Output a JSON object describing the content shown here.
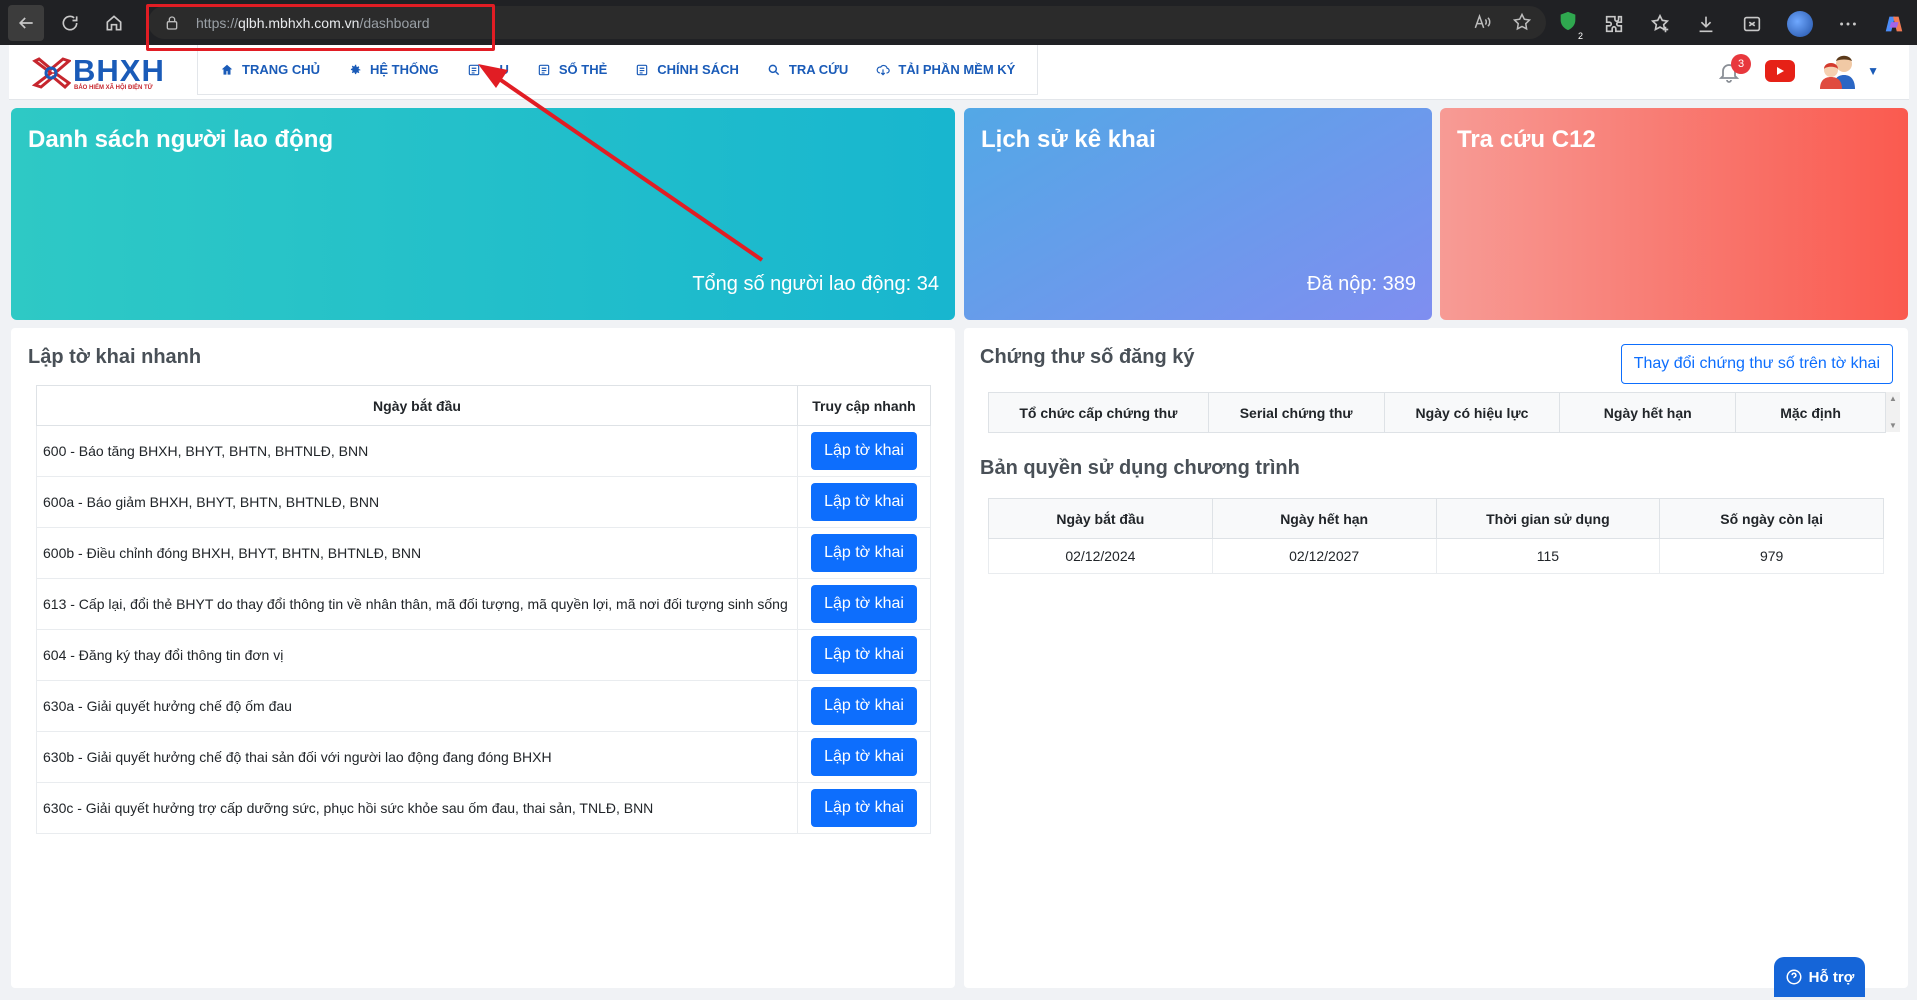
{
  "browser": {
    "url_prefix": "https://",
    "url_host": "qlbh.mbhxh.com.vn",
    "url_path": "/dashboard",
    "extension_badge": "2"
  },
  "header": {
    "logo_text": "BHXH",
    "logo_tagline": "BẢO HIỂM XÃ HỘI ĐIỆN TỬ",
    "menu": [
      {
        "label": "TRANG CHỦ",
        "icon": "home-icon"
      },
      {
        "label": "HỆ THỐNG",
        "icon": "gear-icon"
      },
      {
        "label": "...U",
        "icon": "document-icon"
      },
      {
        "label": "SỔ THẺ",
        "icon": "card-icon"
      },
      {
        "label": "CHÍNH SÁCH",
        "icon": "policy-icon"
      },
      {
        "label": "TRA CỨU",
        "icon": "search-icon"
      },
      {
        "label": "TẢI PHẦN MỀM KÝ",
        "icon": "cloud-download-icon"
      }
    ],
    "notification_count": "3"
  },
  "cards": [
    {
      "title": "Danh sách người lao động",
      "value": "Tổng số người lao động: 34"
    },
    {
      "title": "Lịch sử kê khai",
      "value": "Đã nộp: 389"
    },
    {
      "title": "Tra cứu C12",
      "value": ""
    }
  ],
  "quick_form": {
    "title": "Lập tờ khai nhanh",
    "col1": "Ngày bắt đầu",
    "col2": "Truy cập nhanh",
    "button_label": "Lập tờ khai",
    "rows": [
      "600 - Báo tăng BHXH, BHYT, BHTN, BHTNLĐ, BNN",
      "600a - Báo giảm BHXH, BHYT, BHTN, BHTNLĐ, BNN",
      "600b - Điều chỉnh đóng BHXH, BHYT, BHTN, BHTNLĐ, BNN",
      "613 - Cấp lại, đổi thẻ BHYT do thay đổi thông tin về nhân thân, mã đối tượng, mã quyền lợi, mã nơi đối tượng sinh sống",
      "604 - Đăng ký thay đổi thông tin đơn vị",
      "630a - Giải quyết hưởng chế độ ốm đau",
      "630b - Giải quyết hưởng chế độ thai sản đối với người lao động đang đóng BHXH",
      "630c - Giải quyết hưởng trợ cấp dưỡng sức, phục hồi sức khỏe sau ốm đau, thai sản, TNLĐ, BNN"
    ]
  },
  "certificates": {
    "title": "Chứng thư số đăng ký",
    "change_button": "Thay đổi chứng thư số trên tờ khai",
    "columns": [
      "Tổ chức cấp chứng thư",
      "Serial chứng thư",
      "Ngày có hiệu lực",
      "Ngày hết hạn",
      "Mặc định"
    ]
  },
  "license": {
    "title": "Bản quyền sử dụng chương trình",
    "columns": [
      "Ngày bắt đầu",
      "Ngày hết hạn",
      "Thời gian sử dụng",
      "Số ngày còn lại"
    ],
    "row": [
      "02/12/2024",
      "02/12/2027",
      "115",
      "979"
    ]
  },
  "support_label": "Hỗ trợ",
  "colors": {
    "accent": "#0d6efd",
    "brand": "#1a5bb8",
    "card1": "#18b6cf",
    "card2": "#7f8ef0",
    "card3": "#fa5a4f",
    "annotation": "#e11d24"
  }
}
